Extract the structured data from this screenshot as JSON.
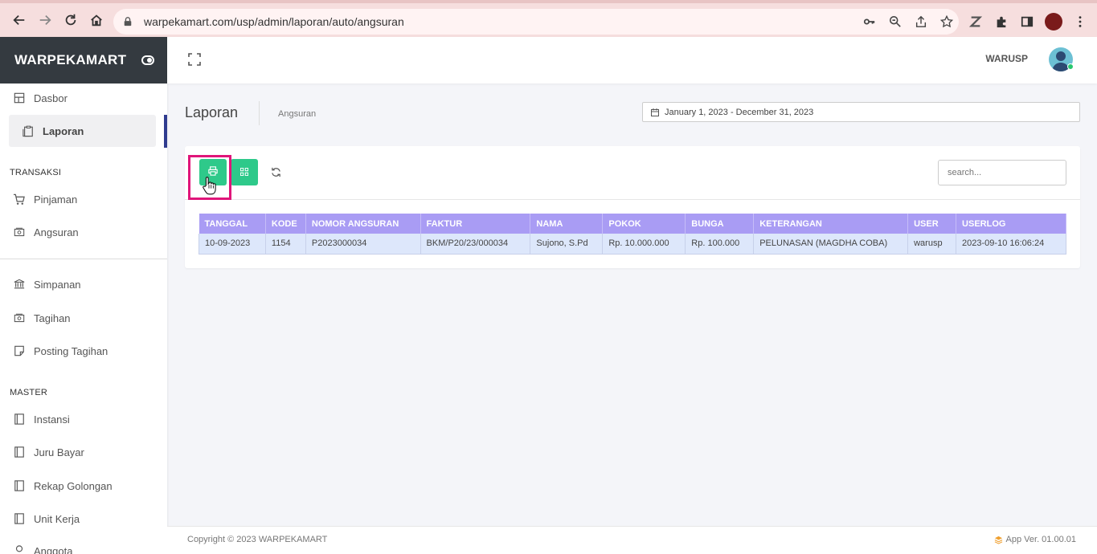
{
  "browser": {
    "url": "warpekamart.com/usp/admin/laporan/auto/angsuran"
  },
  "sidebar": {
    "brand": "WARPEKAMART",
    "top_items": [
      {
        "label": "Dasbor",
        "icon": "dashboard-icon"
      },
      {
        "label": "Laporan",
        "icon": "report-icon",
        "active": true
      }
    ],
    "section_transaksi": "TRANSAKSI",
    "transaksi_items": [
      {
        "label": "Pinjaman",
        "icon": "cart-icon"
      },
      {
        "label": "Angsuran",
        "icon": "money-icon"
      },
      {
        "label": "Simpanan",
        "icon": "bank-icon"
      },
      {
        "label": "Tagihan",
        "icon": "money-icon"
      },
      {
        "label": "Posting Tagihan",
        "icon": "note-icon"
      }
    ],
    "section_master": "MASTER",
    "master_items": [
      {
        "label": "Instansi",
        "icon": "book-icon"
      },
      {
        "label": "Juru Bayar",
        "icon": "book-icon"
      },
      {
        "label": "Rekap Golongan",
        "icon": "book-icon"
      },
      {
        "label": "Unit Kerja",
        "icon": "book-icon"
      },
      {
        "label": "Anggota",
        "icon": "user-icon"
      }
    ]
  },
  "header": {
    "username": "WARUSP"
  },
  "page": {
    "title": "Laporan",
    "breadcrumb": "Angsuran",
    "date_range": "January 1, 2023 - December 31, 2023"
  },
  "toolbar": {
    "search_placeholder": "search..."
  },
  "table": {
    "columns": [
      "TANGGAL",
      "KODE",
      "NOMOR ANGSURAN",
      "FAKTUR",
      "NAMA",
      "POKOK",
      "BUNGA",
      "KETERANGAN",
      "USER",
      "USERLOG"
    ],
    "rows": [
      [
        "10-09-2023",
        "1154",
        "P2023000034",
        "BKM/P20/23/000034",
        "Sujono, S.Pd",
        "Rp. 10.000.000",
        "Rp. 100.000",
        "PELUNASAN (MAGDHA COBA)",
        "warusp",
        "2023-09-10 16:06:24"
      ]
    ]
  },
  "footer": {
    "copyright": "Copyright © 2023 WARPEKAMART",
    "version": "App Ver. 01.00.01"
  },
  "colors": {
    "brand_bg": "#343a40",
    "accent_green": "#2ec98a",
    "table_header": "#a99cf4",
    "table_row": "#dde7fb",
    "highlight": "#e0157a"
  }
}
